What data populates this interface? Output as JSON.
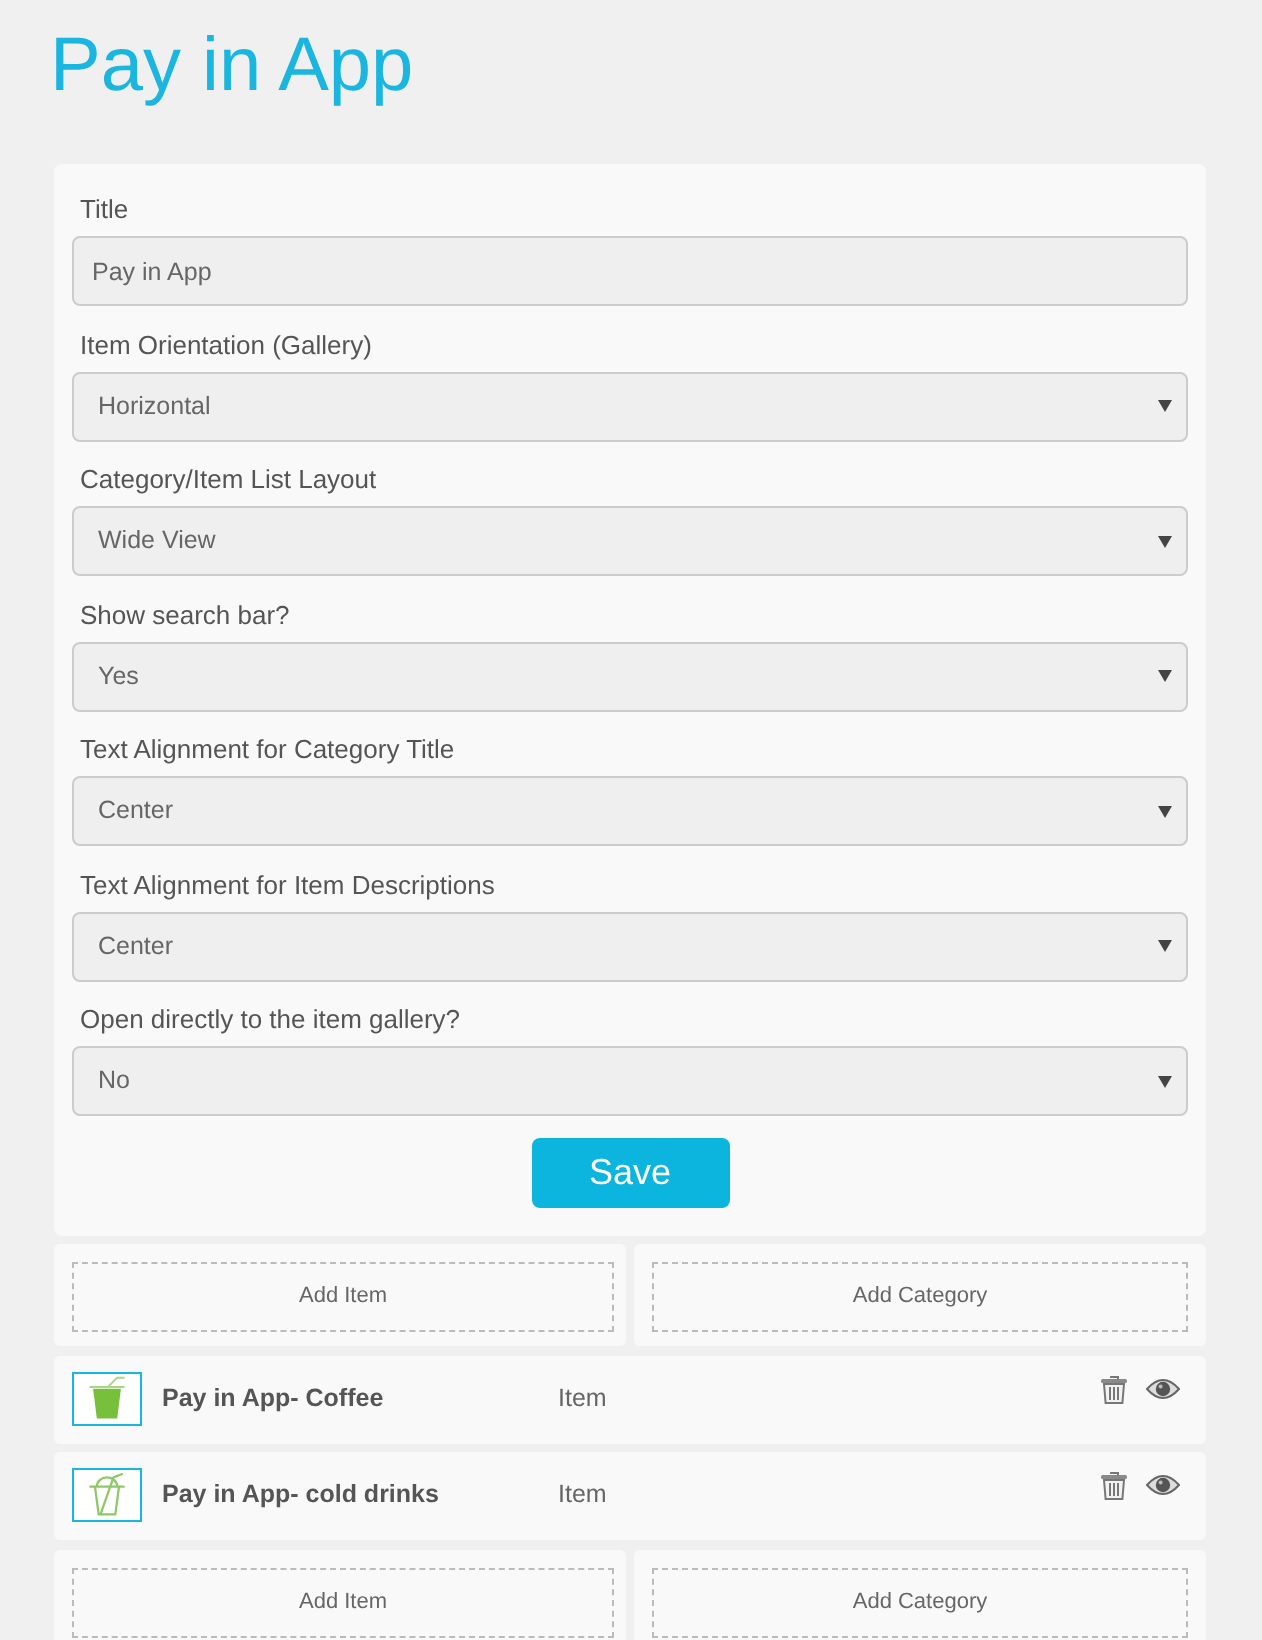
{
  "page_title": "Pay in App",
  "settings_form": {
    "fields": [
      {
        "label": "Title",
        "kind": "text",
        "value": "Pay in App"
      },
      {
        "label": "Item Orientation (Gallery)",
        "kind": "select",
        "value": "Horizontal"
      },
      {
        "label": "Category/Item List Layout",
        "kind": "select",
        "value": "Wide View"
      },
      {
        "label": "Show search bar?",
        "kind": "select",
        "value": "Yes"
      },
      {
        "label": "Text Alignment for Category Title",
        "kind": "select",
        "value": "Center"
      },
      {
        "label": "Text Alignment for Item Descriptions",
        "kind": "select",
        "value": "Center"
      },
      {
        "label": "Open directly to the item gallery?",
        "kind": "select",
        "value": "No"
      }
    ],
    "save_button": "Save"
  },
  "sections": [
    {
      "kind": "add_row",
      "add_item": "Add Item",
      "add_category": "Add Category"
    },
    {
      "kind": "item",
      "name": "Pay in App- Coffee",
      "type": "Item",
      "thumbnail_filled": true
    },
    {
      "kind": "item",
      "name": "Pay in App- cold drinks",
      "type": "Item",
      "thumbnail_filled": false
    },
    {
      "kind": "add_row",
      "add_item": "Add Item",
      "add_category": "Add Category"
    }
  ]
}
